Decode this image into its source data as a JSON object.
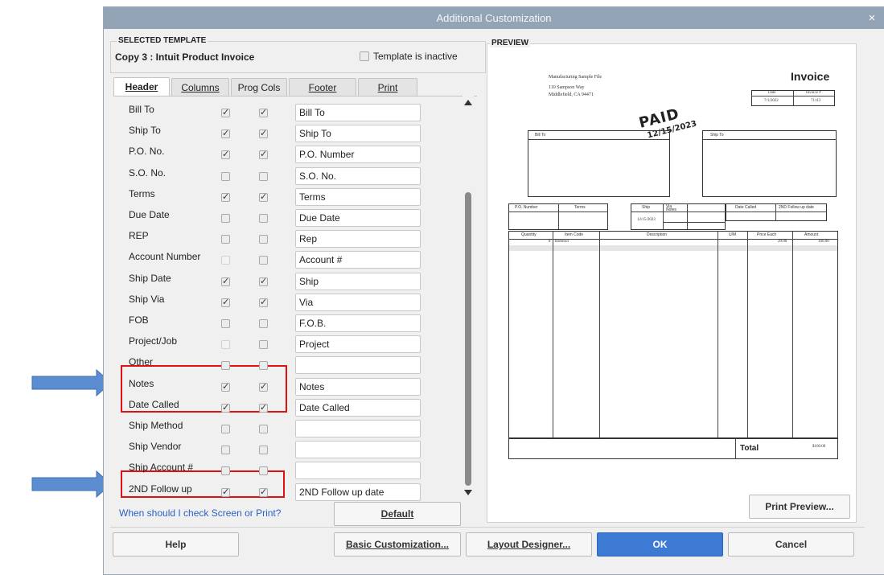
{
  "window": {
    "title": "Additional Customization",
    "close_glyph": "×"
  },
  "selected_template": {
    "label": "SELECTED TEMPLATE",
    "name": "Copy 3 : Intuit Product Invoice",
    "inactive_label": "Template is inactive",
    "inactive_checked": false
  },
  "tabs": [
    {
      "label": "Header",
      "active": true
    },
    {
      "label": "Columns",
      "active": false
    },
    {
      "label": "Prog Cols",
      "active": false
    },
    {
      "label": "Footer",
      "active": false
    },
    {
      "label": "Print",
      "active": false
    }
  ],
  "rows": [
    {
      "label": "Bill To",
      "screen": true,
      "print": true,
      "title": "Bill To"
    },
    {
      "label": "Ship To",
      "screen": true,
      "print": true,
      "title": "Ship To"
    },
    {
      "label": "P.O. No.",
      "screen": true,
      "print": true,
      "title": "P.O. Number"
    },
    {
      "label": "S.O. No.",
      "screen": false,
      "print": false,
      "title": "S.O. No."
    },
    {
      "label": "Terms",
      "screen": true,
      "print": true,
      "title": "Terms"
    },
    {
      "label": "Due Date",
      "screen": false,
      "print": false,
      "title": "Due Date"
    },
    {
      "label": "REP",
      "screen": false,
      "print": false,
      "title": "Rep"
    },
    {
      "label": "Account Number",
      "screen": false,
      "print": false,
      "title": "Account #",
      "screen_disabled": true
    },
    {
      "label": "Ship Date",
      "screen": true,
      "print": true,
      "title": "Ship"
    },
    {
      "label": "Ship Via",
      "screen": true,
      "print": true,
      "title": "Via"
    },
    {
      "label": "FOB",
      "screen": false,
      "print": false,
      "title": "F.O.B."
    },
    {
      "label": "Project/Job",
      "screen": false,
      "print": false,
      "title": "Project",
      "screen_disabled": true
    },
    {
      "label": "Other",
      "screen": false,
      "print": false,
      "title": ""
    },
    {
      "label": "Notes",
      "screen": true,
      "print": true,
      "title": "Notes"
    },
    {
      "label": "Date Called",
      "screen": true,
      "print": true,
      "title": "Date Called"
    },
    {
      "label": "Ship Method",
      "screen": false,
      "print": false,
      "title": ""
    },
    {
      "label": "Ship Vendor",
      "screen": false,
      "print": false,
      "title": ""
    },
    {
      "label": "Ship Account #",
      "screen": false,
      "print": false,
      "title": ""
    },
    {
      "label": "2ND Follow up",
      "screen": true,
      "print": true,
      "title": "2ND Follow up date"
    }
  ],
  "help_link": "When should I check Screen or Print?",
  "buttons": {
    "default": "Default",
    "print_preview": "Print Preview...",
    "help": "Help",
    "basic": "Basic Customization...",
    "layout": "Layout Designer...",
    "ok": "OK",
    "cancel": "Cancel"
  },
  "preview": {
    "label": "PREVIEW",
    "company": "Manufacturing Sample File",
    "address1": "110 Sampson Way",
    "address2": "Middlefield, CA  94471",
    "doc_title": "Invoice",
    "date_head": "Date",
    "invoice_head": "Invoice #",
    "date_val": "7/1/2022",
    "invoice_val": "71113",
    "stamp": "PAID",
    "stamp_date": "12/15/2023",
    "bill_to": "Bill To",
    "ship_to": "Ship To",
    "mid_heads": [
      "P.O. Number",
      "Terms",
      "Ship",
      "Via",
      "Notes",
      "Date Called",
      "2ND Follow up date"
    ],
    "ship_val": "12/15/2023",
    "col_heads": [
      "Quantity",
      "Item Code",
      "Description",
      "U/M",
      "Price Each",
      "Amount"
    ],
    "line_item": {
      "qty": "8",
      "code": "Barstool",
      "price": "20.00",
      "amount": "160.00"
    },
    "total_label": "Total",
    "total_value": "$160.00"
  },
  "colors": {
    "accent": "#3d7ad4",
    "title_bar": "#93a4b7",
    "highlight": "#e01010",
    "arrow": "#5b8dd0"
  },
  "icons": [
    "close-icon",
    "checkbox-icon",
    "scroll-up-icon",
    "scroll-down-icon",
    "arrow-right-icon"
  ]
}
